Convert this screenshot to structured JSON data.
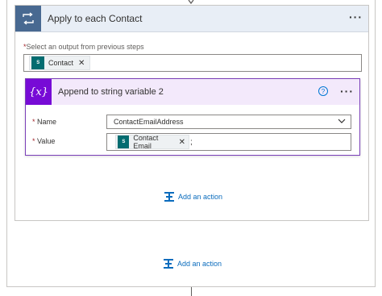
{
  "apply_each": {
    "title": "Apply to each Contact",
    "more_label": "···",
    "select_label": "Select an output from previous steps",
    "select_required": "*",
    "token": {
      "label": "Contact",
      "icon": "sharepoint-icon",
      "icon_text": "S",
      "close": "✕"
    }
  },
  "append_action": {
    "title": "Append to string variable 2",
    "icon_text": "{x}",
    "help": "?",
    "more_label": "···",
    "fields": {
      "name": {
        "required": "*",
        "label": "Name",
        "value": "ContactEmailAddress"
      },
      "value": {
        "required": "*",
        "label": "Value",
        "token": {
          "label": "Contact Email",
          "icon_text": "S",
          "close": "✕"
        },
        "suffix": ";"
      }
    }
  },
  "inner_add_action": {
    "label": "Add an action"
  },
  "outer_add_action": {
    "label": "Add an action"
  },
  "colors": {
    "loop_tile": "#486991",
    "variable_tile": "#770bd6",
    "sharepoint": "#036c70",
    "link": "#0b6cbd"
  }
}
